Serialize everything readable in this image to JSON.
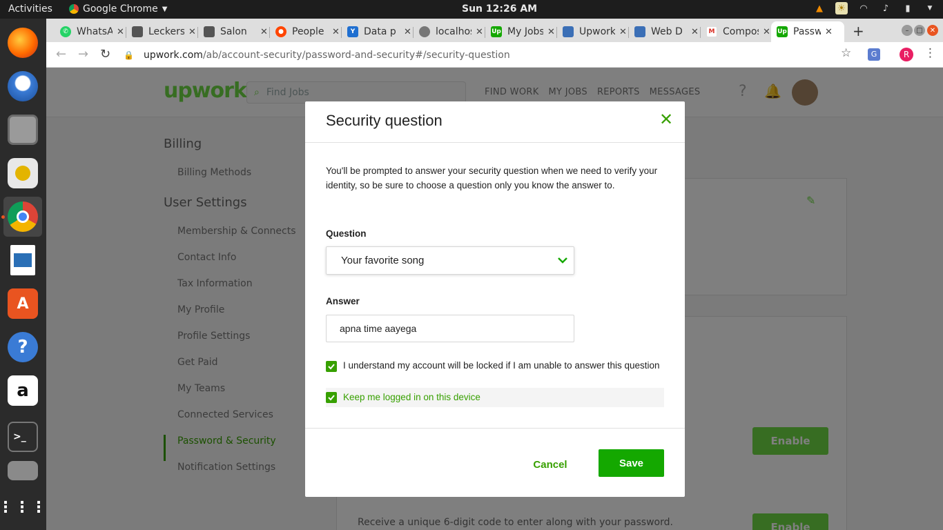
{
  "topbar": {
    "activities": "Activities",
    "app_name": "Google Chrome",
    "clock": "Sun 12:26 AM"
  },
  "dock": {
    "items": [
      "firefox",
      "thunderbird",
      "files",
      "rhythmbox",
      "chrome",
      "libreoffice-writer",
      "ubuntu-software",
      "help",
      "amazon",
      "terminal",
      "system-tool",
      "show-apps"
    ]
  },
  "browser": {
    "tabs": [
      {
        "title": "WhatsApp",
        "favicon": "whatsapp-icon",
        "color": "#25d366"
      },
      {
        "title": "Leckers",
        "favicon": "page-icon",
        "color": "#555555"
      },
      {
        "title": "Salon",
        "favicon": "page-icon",
        "color": "#555555"
      },
      {
        "title": "People",
        "favicon": "reddit-icon",
        "color": "#ff4500"
      },
      {
        "title": "Data p",
        "favicon": "ytrip-icon",
        "color": "#1f6fd0"
      },
      {
        "title": "localhost",
        "favicon": "globe-icon",
        "color": "#777777"
      },
      {
        "title": "My Jobs",
        "favicon": "upwork-icon",
        "color": "#14a800"
      },
      {
        "title": "Upwork",
        "favicon": "upwork-alt-icon",
        "color": "#3b6fb6"
      },
      {
        "title": "Web D",
        "favicon": "upwork-alt-icon",
        "color": "#3b6fb6"
      },
      {
        "title": "Compose",
        "favicon": "gmail-icon",
        "color": "#d93025"
      },
      {
        "title": "Password",
        "favicon": "upwork-icon",
        "color": "#14a800"
      }
    ],
    "url_host": "upwork.com",
    "url_path": "/ab/account-security/password-and-security#/security-question",
    "profile_initial": "R"
  },
  "upwork": {
    "search_placeholder": "Find Jobs",
    "nav": [
      "FIND WORK",
      "MY JOBS",
      "REPORTS",
      "MESSAGES"
    ],
    "sidebar": {
      "billing_heading": "Billing",
      "billing_items": [
        "Billing Methods"
      ],
      "user_heading": "User Settings",
      "user_items": [
        "Membership & Connects",
        "Contact Info",
        "Tax Information",
        "My Profile",
        "Profile Settings",
        "Get Paid",
        "My Teams",
        "Connected Services",
        "Password & Security",
        "Notification Settings"
      ]
    },
    "bg_text": "Receive a unique 6-digit code to enter along with your password.",
    "enable_label": "Enable"
  },
  "modal": {
    "title": "Security question",
    "description": "You'll be prompted to answer your security question when we need to verify your identity, so be sure to choose a question only you know the answer to.",
    "question_label": "Question",
    "question_value": "Your favorite song",
    "answer_label": "Answer",
    "answer_value": "apna time aayega",
    "check1_label": "I understand my account will be locked if I am unable to answer this question",
    "check1_checked": true,
    "check2_label": "Keep me logged in on this device",
    "check2_checked": true,
    "cancel_label": "Cancel",
    "save_label": "Save",
    "accent": "#14a800"
  }
}
